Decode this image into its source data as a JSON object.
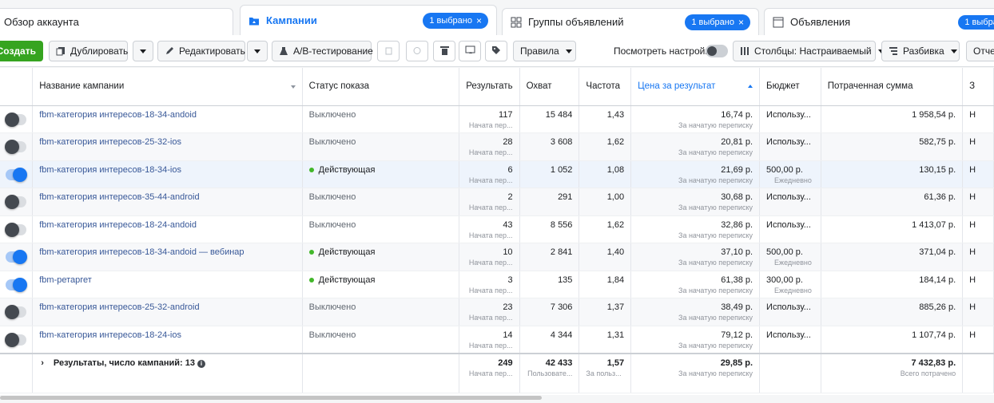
{
  "tabs": {
    "overview": "Обзор аккаунта",
    "campaigns": "Кампании",
    "adsets": "Группы объявлений",
    "ads": "Объявления",
    "selected": "1 выбрано"
  },
  "toolbar": {
    "create": "Создать",
    "duplicate": "Дублировать",
    "edit": "Редактировать",
    "ab_test": "A/B-тестирование",
    "rules": "Правила",
    "view_settings": "Посмотреть настройки",
    "columns": "Столбцы: Настраиваемый",
    "breakdown": "Разбивка",
    "reports": "Отчет"
  },
  "columns": {
    "name": "Название кампании",
    "status": "Статус показа",
    "result": "Результать",
    "reach": "Охват",
    "frequency": "Частота",
    "cost": "Цена за результат",
    "budget": "Бюджет",
    "spent": "Потраченная сумма",
    "extra": "З"
  },
  "rows": [
    {
      "on": false,
      "name": "fbm-категория интересов-18-34-andoid",
      "status": "Выключено",
      "active": false,
      "result": "117",
      "result_sub": "Начата пер...",
      "reach": "15 484",
      "freq": "1,43",
      "cost": "16,74 р.",
      "cost_sub": "За начатую переписку",
      "budget": "Использу...",
      "budget_sub": "",
      "spent": "1 958,54 р.",
      "extra": "Н"
    },
    {
      "on": false,
      "name": "fbm-категория интересов-25-32-ios",
      "status": "Выключено",
      "active": false,
      "result": "28",
      "result_sub": "Начата пер...",
      "reach": "3 608",
      "freq": "1,62",
      "cost": "20,81 р.",
      "cost_sub": "За начатую переписку",
      "budget": "Использу...",
      "budget_sub": "",
      "spent": "582,75 р.",
      "extra": "Н"
    },
    {
      "on": true,
      "name": "fbm-категория интересов-18-34-ios",
      "status": "Действующая",
      "active": true,
      "result": "6",
      "result_sub": "Начата пер...",
      "reach": "1 052",
      "freq": "1,08",
      "cost": "21,69 р.",
      "cost_sub": "За начатую переписку",
      "budget": "500,00 р.",
      "budget_sub": "Ежедневно",
      "spent": "130,15 р.",
      "extra": "Н"
    },
    {
      "on": false,
      "name": "fbm-категория интересов-35-44-android",
      "status": "Выключено",
      "active": false,
      "result": "2",
      "result_sub": "Начата пер...",
      "reach": "291",
      "freq": "1,00",
      "cost": "30,68 р.",
      "cost_sub": "За начатую переписку",
      "budget": "Использу...",
      "budget_sub": "",
      "spent": "61,36 р.",
      "extra": "Н"
    },
    {
      "on": false,
      "name": "fbm-категория интересов-18-24-andoid",
      "status": "Выключено",
      "active": false,
      "result": "43",
      "result_sub": "Начата пер...",
      "reach": "8 556",
      "freq": "1,62",
      "cost": "32,86 р.",
      "cost_sub": "За начатую переписку",
      "budget": "Использу...",
      "budget_sub": "",
      "spent": "1 413,07 р.",
      "extra": "Н"
    },
    {
      "on": true,
      "name": "fbm-категория интересов-18-34-andoid — вебинар",
      "status": "Действующая",
      "active": true,
      "result": "10",
      "result_sub": "Начата пер...",
      "reach": "2 841",
      "freq": "1,40",
      "cost": "37,10 р.",
      "cost_sub": "За начатую переписку",
      "budget": "500,00 р.",
      "budget_sub": "Ежедневно",
      "spent": "371,04 р.",
      "extra": "Н"
    },
    {
      "on": true,
      "name": "fbm-ретаргет",
      "status": "Действующая",
      "active": true,
      "result": "3",
      "result_sub": "Начата пер...",
      "reach": "135",
      "freq": "1,84",
      "cost": "61,38 р.",
      "cost_sub": "За начатую переписку",
      "budget": "300,00 р.",
      "budget_sub": "Ежедневно",
      "spent": "184,14 р.",
      "extra": "Н"
    },
    {
      "on": false,
      "name": "fbm-категория интересов-25-32-android",
      "status": "Выключено",
      "active": false,
      "result": "23",
      "result_sub": "Начата пер...",
      "reach": "7 306",
      "freq": "1,37",
      "cost": "38,49 р.",
      "cost_sub": "За начатую переписку",
      "budget": "Использу...",
      "budget_sub": "",
      "spent": "885,26 р.",
      "extra": "Н"
    },
    {
      "on": false,
      "name": "fbm-категория интересов-18-24-ios",
      "status": "Выключено",
      "active": false,
      "result": "14",
      "result_sub": "Начата пер...",
      "reach": "4 344",
      "freq": "1,31",
      "cost": "79,12 р.",
      "cost_sub": "За начатую переписку",
      "budget": "Использу...",
      "budget_sub": "",
      "spent": "1 107,74 р.",
      "extra": "Н"
    }
  ],
  "totals": {
    "label": "Результаты, число кампаний: 13",
    "result": "249",
    "result_sub": "Начата пер...",
    "reach": "42 433",
    "reach_sub": "Пользовате...",
    "freq": "1,57",
    "freq_sub": "За польз...",
    "cost": "29,85 р.",
    "cost_sub": "За начатую переписку",
    "spent": "7 432,83 р.",
    "spent_sub": "Всего потрачено"
  }
}
